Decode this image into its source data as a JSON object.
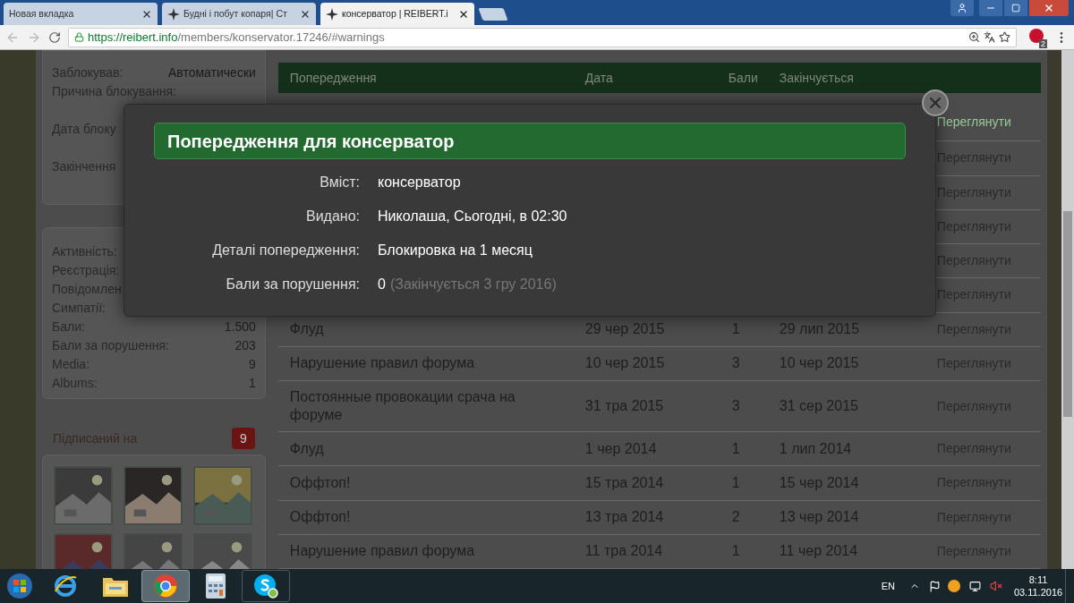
{
  "browser": {
    "tabs": [
      {
        "title": "Новая вкладка",
        "selected": false,
        "has_icon": false
      },
      {
        "title": "Будні і побут копаря| Ст",
        "selected": false,
        "has_icon": true
      },
      {
        "title": "консерватор | REIBERT.i",
        "selected": true,
        "has_icon": true
      }
    ],
    "url": {
      "host": "https://reibert.info",
      "path": "/members/konservator.17246/#warnings"
    },
    "extension_badge": "2"
  },
  "sidebar": {
    "ban_box": [
      {
        "label": "Заблокував:",
        "value": "Автоматически"
      },
      {
        "label": "Причина блокування:"
      },
      {
        "label": "Дата блоку"
      },
      {
        "label": "Закінчення"
      }
    ],
    "stats": [
      {
        "label": "Активність:"
      },
      {
        "label": "Реєстрація:"
      },
      {
        "label": "Повідомлен"
      },
      {
        "label": "Симпатії:"
      },
      {
        "label": "Бали:",
        "value": "1.500"
      },
      {
        "label": "Бали за порушення:",
        "value": "203"
      },
      {
        "label": "Media:",
        "value": "9"
      },
      {
        "label": "Albums:",
        "value": "1"
      }
    ],
    "following": {
      "title": "Підписаний на",
      "count": "9"
    }
  },
  "table": {
    "columns": [
      "Попередження",
      "Дата",
      "Бали",
      "Закінчується"
    ],
    "rows": [
      {
        "action": "Переглянути"
      },
      {
        "action": "Переглянути"
      },
      {
        "action": "Переглянути"
      },
      {
        "action": "Переглянути"
      },
      {
        "action": "Переглянути"
      },
      {
        "action": "Переглянути"
      },
      {
        "warning": "Флуд",
        "date": "29 чер 2015",
        "points": "1",
        "expires": "29 лип 2015",
        "action": "Переглянути"
      },
      {
        "warning": "Нарушение правил форума",
        "date": "10 чер 2015",
        "points": "3",
        "expires": "10 чер 2015",
        "action": "Переглянути"
      },
      {
        "warning": "Постоянные провокации срача на форуме",
        "date": "31 тра 2015",
        "points": "3",
        "expires": "31 сер 2015",
        "action": "Переглянути"
      },
      {
        "warning": "Флуд",
        "date": "1 чер 2014",
        "points": "1",
        "expires": "1 лип 2014",
        "action": "Переглянути"
      },
      {
        "warning": "Оффтоп!",
        "date": "15 тра 2014",
        "points": "1",
        "expires": "15 чер 2014",
        "action": "Переглянути"
      },
      {
        "warning": "Оффтоп!",
        "date": "13 тра 2014",
        "points": "2",
        "expires": "13 чер 2014",
        "action": "Переглянути"
      },
      {
        "warning": "Нарушение правил форума",
        "date": "11 тра 2014",
        "points": "1",
        "expires": "11 чер 2014",
        "action": "Переглянути"
      }
    ]
  },
  "dialog": {
    "title": "Попередження для консерватор",
    "fields": [
      {
        "label": "Вміст:",
        "value": "консерватор"
      },
      {
        "label": "Видано:",
        "value": "Николаша, Сьогодні, в 02:30"
      },
      {
        "label": "Деталі попередження:",
        "value": "Блокировка на 1 месяц"
      },
      {
        "label": "Бали за порушення:",
        "value": "0",
        "note": "(Закінчується 3 гру 2016)"
      }
    ]
  },
  "taskbar": {
    "apps": [
      {
        "kind": "ie",
        "selected": false
      },
      {
        "kind": "folder",
        "selected": false
      },
      {
        "kind": "chrome",
        "selected": true
      },
      {
        "kind": "calculator",
        "selected": false
      },
      {
        "kind": "skype",
        "selected": false
      }
    ],
    "language": "EN",
    "time": "8:11",
    "date": "03.11.2016"
  }
}
